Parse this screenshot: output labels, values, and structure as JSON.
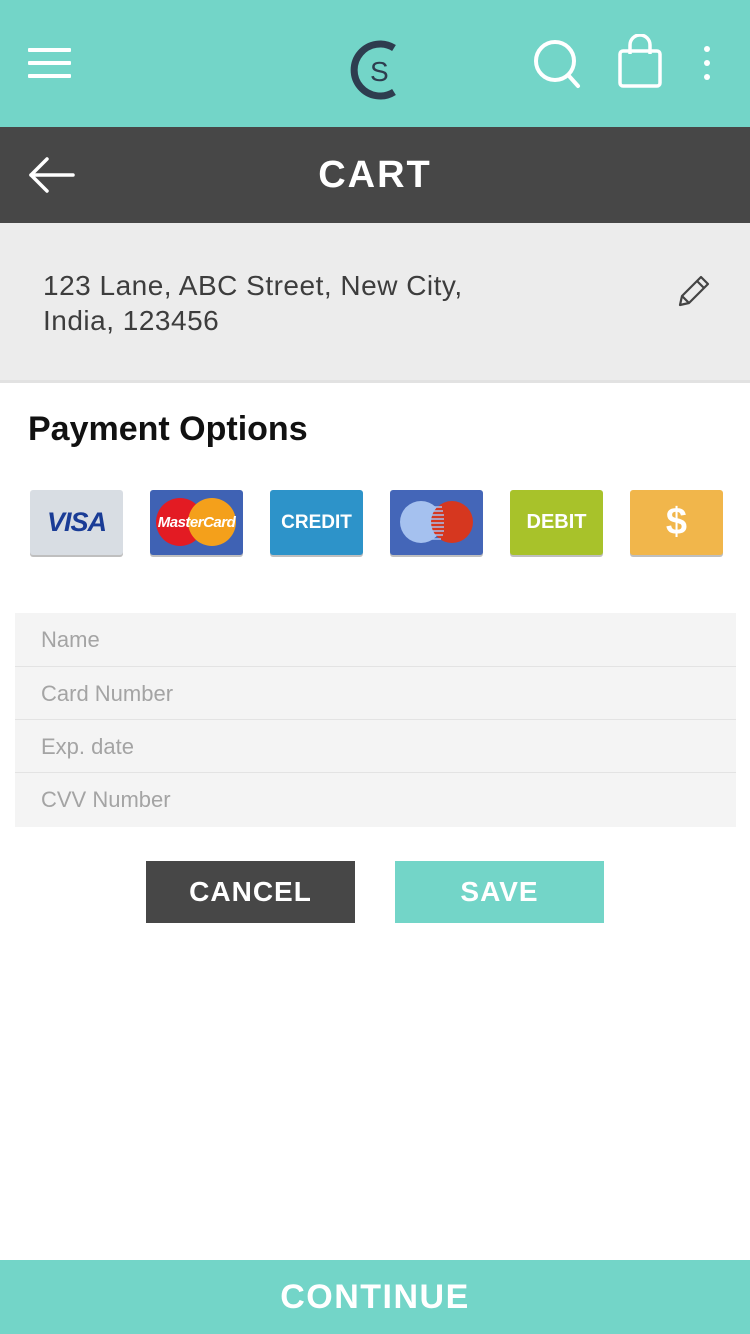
{
  "header": {
    "logo_letter": "S",
    "icons": [
      "menu-icon",
      "logo-icon",
      "search-icon",
      "shopping-bag-icon",
      "more-vertical-icon"
    ]
  },
  "cart_bar": {
    "title": "CART",
    "back_icon": "arrow-left-icon"
  },
  "address": {
    "line1": "123 Lane, ABC Street, New City,",
    "line2": "India, 123456",
    "edit_icon": "pencil-icon"
  },
  "payment": {
    "title": "Payment Options",
    "cards": [
      {
        "name": "visa",
        "label": "VISA",
        "color": "#d8dde3",
        "text_color": "#1a3c96"
      },
      {
        "name": "mastercard",
        "label": "MasterCard",
        "color": "#3f62b4"
      },
      {
        "name": "credit",
        "label": "CREDIT",
        "color": "#2d93c9"
      },
      {
        "name": "maestro",
        "label": "",
        "color": "#4466b8"
      },
      {
        "name": "debit",
        "label": "DEBIT",
        "color": "#a8c22a"
      },
      {
        "name": "cash",
        "label": "$",
        "color": "#f1b64b"
      }
    ]
  },
  "form": {
    "name_placeholder": "Name",
    "card_number_placeholder": "Card Number",
    "exp_date_placeholder": "Exp. date",
    "cvv_placeholder": "CVV Number"
  },
  "actions": {
    "cancel_label": "CANCEL",
    "save_label": "SAVE"
  },
  "footer": {
    "continue_label": "CONTINUE"
  },
  "colors": {
    "accent": "#73d5c8",
    "dark_bar": "#474747",
    "address_bg": "#ececec"
  }
}
